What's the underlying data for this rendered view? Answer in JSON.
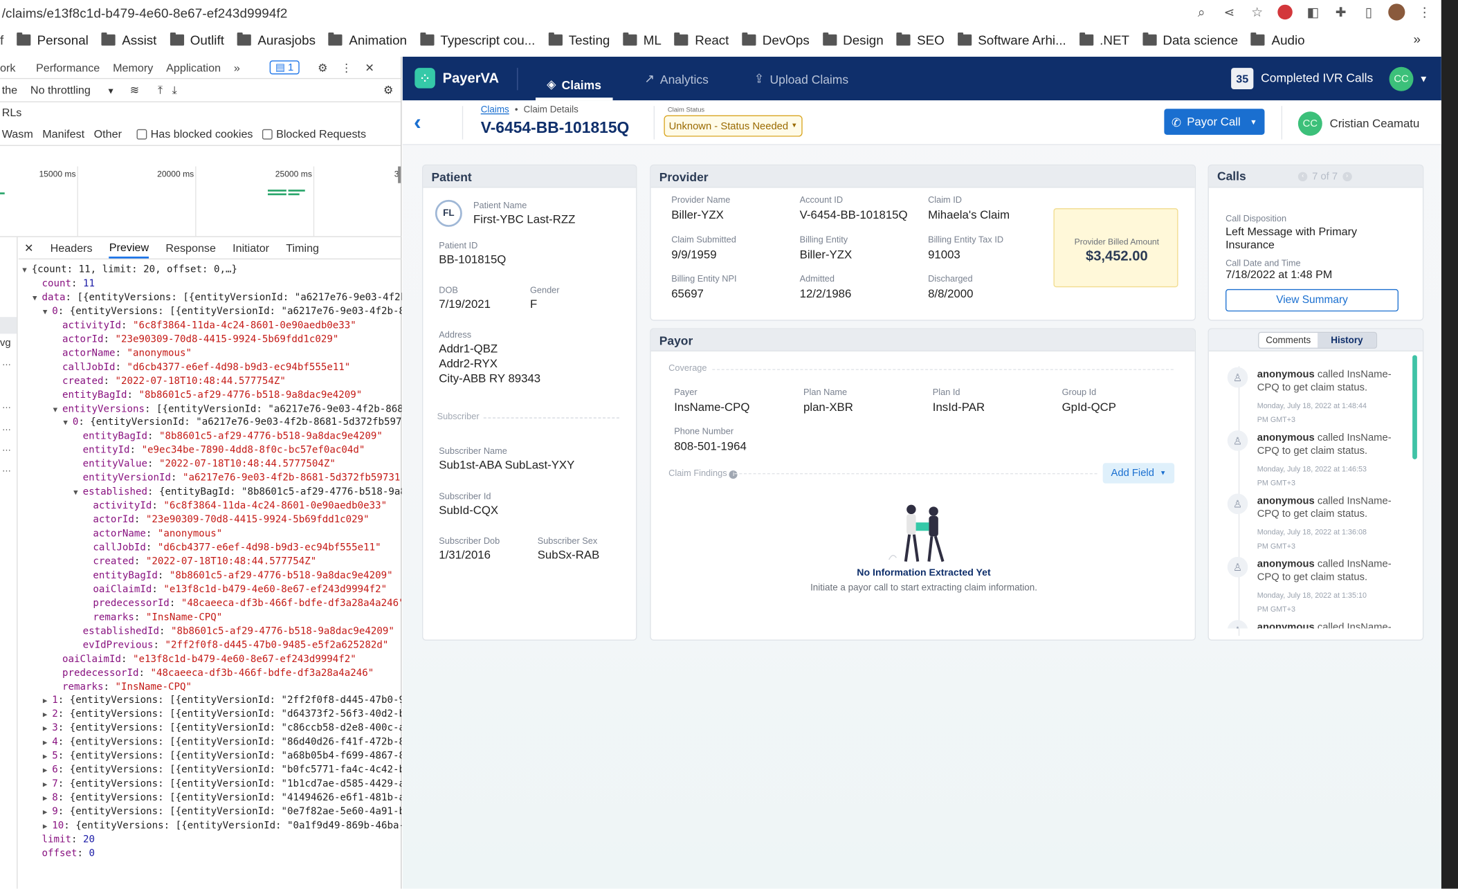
{
  "browser": {
    "url": "/claims/e13f8c1d-b479-4e60-8e67-ef243d9994f2",
    "bookmarks": [
      "Personal",
      "Assist",
      "Outlift",
      "Aurasjobs",
      "Animation",
      "Typescript cou...",
      "Testing",
      "ML",
      "React",
      "DevOps",
      "Design",
      "SEO",
      "Software Arhi...",
      ".NET",
      "Data science",
      "Audio"
    ],
    "more": "»"
  },
  "devtools": {
    "top_tabs": [
      "ork",
      "Performance",
      "Memory",
      "Application",
      "»"
    ],
    "issues_count": "1",
    "throttle_prefix": "the",
    "throttling": "No throttling",
    "urls_label": "RLs",
    "filters": [
      "Wasm",
      "Manifest",
      "Other"
    ],
    "checkbox_blocked_cookies": "Has blocked cookies",
    "checkbox_blocked_requests": "Blocked Requests",
    "timeline": [
      "15000 ms",
      "20000 ms",
      "25000 ms",
      "3"
    ],
    "panel_tabs": [
      "Headers",
      "Preview",
      "Response",
      "Initiator",
      "Timing"
    ],
    "side_labels": [
      "vg"
    ],
    "json_lines": [
      {
        "t": "▼",
        "i": 0,
        "c": [
          [
            "p",
            "{count: 11, limit: 20, offset: 0,…}"
          ]
        ]
      },
      {
        "t": "",
        "i": 1,
        "c": [
          [
            "k",
            "count"
          ],
          [
            "p",
            ": "
          ],
          [
            "n",
            "11"
          ]
        ]
      },
      {
        "t": "▼",
        "i": 1,
        "c": [
          [
            "k",
            "data"
          ],
          [
            "p",
            ": [{entityVersions: [{entityVersionId: \"a6217e76-9e03-4f2b-"
          ]
        ]
      },
      {
        "t": "▼",
        "i": 2,
        "c": [
          [
            "k",
            "0"
          ],
          [
            "p",
            ": {entityVersions: [{entityVersionId: \"a6217e76-9e03-4f2b-86"
          ]
        ]
      },
      {
        "t": "",
        "i": 3,
        "c": [
          [
            "k",
            "activityId"
          ],
          [
            "p",
            ": "
          ],
          [
            "s",
            "\"6c8f3864-11da-4c24-8601-0e90aedb0e33\""
          ]
        ]
      },
      {
        "t": "",
        "i": 3,
        "c": [
          [
            "k",
            "actorId"
          ],
          [
            "p",
            ": "
          ],
          [
            "s",
            "\"23e90309-70d8-4415-9924-5b69fdd1c029\""
          ]
        ]
      },
      {
        "t": "",
        "i": 3,
        "c": [
          [
            "k",
            "actorName"
          ],
          [
            "p",
            ": "
          ],
          [
            "s",
            "\"anonymous\""
          ]
        ]
      },
      {
        "t": "",
        "i": 3,
        "c": [
          [
            "k",
            "callJobId"
          ],
          [
            "p",
            ": "
          ],
          [
            "s",
            "\"d6cb4377-e6ef-4d98-b9d3-ec94bf555e11\""
          ]
        ]
      },
      {
        "t": "",
        "i": 3,
        "c": [
          [
            "k",
            "created"
          ],
          [
            "p",
            ": "
          ],
          [
            "s",
            "\"2022-07-18T10:48:44.577754Z\""
          ]
        ]
      },
      {
        "t": "",
        "i": 3,
        "c": [
          [
            "k",
            "entityBagId"
          ],
          [
            "p",
            ": "
          ],
          [
            "s",
            "\"8b8601c5-af29-4776-b518-9a8dac9e4209\""
          ]
        ]
      },
      {
        "t": "▼",
        "i": 3,
        "c": [
          [
            "k",
            "entityVersions"
          ],
          [
            "p",
            ": [{entityVersionId: \"a6217e76-9e03-4f2b-8681"
          ]
        ]
      },
      {
        "t": "▼",
        "i": 4,
        "c": [
          [
            "k",
            "0"
          ],
          [
            "p",
            ": {entityVersionId: \"a6217e76-9e03-4f2b-8681-5d372fb59731"
          ]
        ]
      },
      {
        "t": "",
        "i": 5,
        "c": [
          [
            "k",
            "entityBagId"
          ],
          [
            "p",
            ": "
          ],
          [
            "s",
            "\"8b8601c5-af29-4776-b518-9a8dac9e4209\""
          ]
        ]
      },
      {
        "t": "",
        "i": 5,
        "c": [
          [
            "k",
            "entityId"
          ],
          [
            "p",
            ": "
          ],
          [
            "s",
            "\"e9ec34be-7890-4dd8-8f0c-bc57ef0ac04d\""
          ]
        ]
      },
      {
        "t": "",
        "i": 5,
        "c": [
          [
            "k",
            "entityValue"
          ],
          [
            "p",
            ": "
          ],
          [
            "s",
            "\"2022-07-18T10:48:44.5777504Z\""
          ]
        ]
      },
      {
        "t": "",
        "i": 5,
        "c": [
          [
            "k",
            "entityVersionId"
          ],
          [
            "p",
            ": "
          ],
          [
            "s",
            "\"a6217e76-9e03-4f2b-8681-5d372fb59731\""
          ]
        ]
      },
      {
        "t": "▼",
        "i": 5,
        "c": [
          [
            "k",
            "established"
          ],
          [
            "p",
            ": {entityBagId: \"8b8601c5-af29-4776-b518-9a8d"
          ]
        ]
      },
      {
        "t": "",
        "i": 6,
        "c": [
          [
            "k",
            "activityId"
          ],
          [
            "p",
            ": "
          ],
          [
            "s",
            "\"6c8f3864-11da-4c24-8601-0e90aedb0e33\""
          ]
        ]
      },
      {
        "t": "",
        "i": 6,
        "c": [
          [
            "k",
            "actorId"
          ],
          [
            "p",
            ": "
          ],
          [
            "s",
            "\"23e90309-70d8-4415-9924-5b69fdd1c029\""
          ]
        ]
      },
      {
        "t": "",
        "i": 6,
        "c": [
          [
            "k",
            "actorName"
          ],
          [
            "p",
            ": "
          ],
          [
            "s",
            "\"anonymous\""
          ]
        ]
      },
      {
        "t": "",
        "i": 6,
        "c": [
          [
            "k",
            "callJobId"
          ],
          [
            "p",
            ": "
          ],
          [
            "s",
            "\"d6cb4377-e6ef-4d98-b9d3-ec94bf555e11\""
          ]
        ]
      },
      {
        "t": "",
        "i": 6,
        "c": [
          [
            "k",
            "created"
          ],
          [
            "p",
            ": "
          ],
          [
            "s",
            "\"2022-07-18T10:48:44.577754Z\""
          ]
        ]
      },
      {
        "t": "",
        "i": 6,
        "c": [
          [
            "k",
            "entityBagId"
          ],
          [
            "p",
            ": "
          ],
          [
            "s",
            "\"8b8601c5-af29-4776-b518-9a8dac9e4209\""
          ]
        ]
      },
      {
        "t": "",
        "i": 6,
        "c": [
          [
            "k",
            "oaiClaimId"
          ],
          [
            "p",
            ": "
          ],
          [
            "s",
            "\"e13f8c1d-b479-4e60-8e67-ef243d9994f2\""
          ]
        ]
      },
      {
        "t": "",
        "i": 6,
        "c": [
          [
            "k",
            "predecessorId"
          ],
          [
            "p",
            ": "
          ],
          [
            "s",
            "\"48caeeca-df3b-466f-bdfe-df3a28a4a246\""
          ]
        ]
      },
      {
        "t": "",
        "i": 6,
        "c": [
          [
            "k",
            "remarks"
          ],
          [
            "p",
            ": "
          ],
          [
            "s",
            "\"InsName-CPQ\""
          ]
        ]
      },
      {
        "t": "",
        "i": 5,
        "c": [
          [
            "k",
            "establishedId"
          ],
          [
            "p",
            ": "
          ],
          [
            "s",
            "\"8b8601c5-af29-4776-b518-9a8dac9e4209\""
          ]
        ]
      },
      {
        "t": "",
        "i": 5,
        "c": [
          [
            "k",
            "evIdPrevious"
          ],
          [
            "p",
            ": "
          ],
          [
            "s",
            "\"2ff2f0f8-d445-47b0-9485-e5f2a625282d\""
          ]
        ]
      },
      {
        "t": "",
        "i": 3,
        "c": [
          [
            "k",
            "oaiClaimId"
          ],
          [
            "p",
            ": "
          ],
          [
            "s",
            "\"e13f8c1d-b479-4e60-8e67-ef243d9994f2\""
          ]
        ]
      },
      {
        "t": "",
        "i": 3,
        "c": [
          [
            "k",
            "predecessorId"
          ],
          [
            "p",
            ": "
          ],
          [
            "s",
            "\"48caeeca-df3b-466f-bdfe-df3a28a4a246\""
          ]
        ]
      },
      {
        "t": "",
        "i": 3,
        "c": [
          [
            "k",
            "remarks"
          ],
          [
            "p",
            ": "
          ],
          [
            "s",
            "\"InsName-CPQ\""
          ]
        ]
      },
      {
        "t": "▶",
        "i": 2,
        "c": [
          [
            "k",
            "1"
          ],
          [
            "p",
            ": {entityVersions: [{entityVersionId: \"2ff2f0f8-d445-47b0-94"
          ]
        ]
      },
      {
        "t": "▶",
        "i": 2,
        "c": [
          [
            "k",
            "2"
          ],
          [
            "p",
            ": {entityVersions: [{entityVersionId: \"d64373f2-56f3-40d2-b7"
          ]
        ]
      },
      {
        "t": "▶",
        "i": 2,
        "c": [
          [
            "k",
            "3"
          ],
          [
            "p",
            ": {entityVersions: [{entityVersionId: \"c86ccb58-d2e8-400c-ae"
          ]
        ]
      },
      {
        "t": "▶",
        "i": 2,
        "c": [
          [
            "k",
            "4"
          ],
          [
            "p",
            ": {entityVersions: [{entityVersionId: \"86d40d26-f41f-472b-86"
          ]
        ]
      },
      {
        "t": "▶",
        "i": 2,
        "c": [
          [
            "k",
            "5"
          ],
          [
            "p",
            ": {entityVersions: [{entityVersionId: \"a68b05b4-f699-4867-86"
          ]
        ]
      },
      {
        "t": "▶",
        "i": 2,
        "c": [
          [
            "k",
            "6"
          ],
          [
            "p",
            ": {entityVersions: [{entityVersionId: \"b0fc5771-fa4c-4c42-bd"
          ]
        ]
      },
      {
        "t": "▶",
        "i": 2,
        "c": [
          [
            "k",
            "7"
          ],
          [
            "p",
            ": {entityVersions: [{entityVersionId: \"1b1cd7ae-d585-4429-a5"
          ]
        ]
      },
      {
        "t": "▶",
        "i": 2,
        "c": [
          [
            "k",
            "8"
          ],
          [
            "p",
            ": {entityVersions: [{entityVersionId: \"41494626-e6f1-481b-a1"
          ]
        ]
      },
      {
        "t": "▶",
        "i": 2,
        "c": [
          [
            "k",
            "9"
          ],
          [
            "p",
            ": {entityVersions: [{entityVersionId: \"0e7f82ae-5e60-4a91-b1"
          ]
        ]
      },
      {
        "t": "▶",
        "i": 2,
        "c": [
          [
            "k",
            "10"
          ],
          [
            "p",
            ": {entityVersions: [{entityVersionId: \"0a1f9d49-869b-46ba-a"
          ]
        ]
      },
      {
        "t": "",
        "i": 1,
        "c": [
          [
            "k",
            "limit"
          ],
          [
            "p",
            ": "
          ],
          [
            "n",
            "20"
          ]
        ]
      },
      {
        "t": "",
        "i": 1,
        "c": [
          [
            "k",
            "offset"
          ],
          [
            "p",
            ": "
          ],
          [
            "n",
            "0"
          ]
        ]
      }
    ]
  },
  "app": {
    "brand": "PayerVA",
    "nav": {
      "claims": "Claims",
      "analytics": "Analytics",
      "upload": "Upload Claims"
    },
    "completed_count": "35",
    "completed_label": "Completed IVR Calls",
    "user_initials": "CC",
    "breadcrumb": {
      "link": "Claims",
      "sep": "•",
      "current": "Claim Details"
    },
    "claim_number": "V-6454-BB-101815Q",
    "claim_status_label": "Claim Status",
    "claim_status": "Unknown - Status Needed",
    "payor_call": "Payor Call",
    "user_name": "Cristian Ceamatu",
    "patient": {
      "title": "Patient",
      "initials": "FL",
      "name_label": "Patient Name",
      "name": "First-YBC Last-RZZ",
      "id_label": "Patient ID",
      "id": "BB-101815Q",
      "dob_label": "DOB",
      "dob": "7/19/2021",
      "gender_label": "Gender",
      "gender": "F",
      "address_label": "Address",
      "addr1": "Addr1-QBZ",
      "addr2": "Addr2-RYX",
      "city": "City-ABB RY 89343",
      "subscriber_section": "Subscriber",
      "sub_name_label": "Subscriber Name",
      "sub_name": "Sub1st-ABA SubLast-YXY",
      "sub_id_label": "Subscriber Id",
      "sub_id": "SubId-CQX",
      "sub_dob_label": "Subscriber Dob",
      "sub_dob": "1/31/2016",
      "sub_sex_label": "Subscriber Sex",
      "sub_sex": "SubSx-RAB"
    },
    "provider": {
      "title": "Provider",
      "fields": [
        {
          "label": "Provider Name",
          "value": "Biller-YZX"
        },
        {
          "label": "Account ID",
          "value": "V-6454-BB-101815Q"
        },
        {
          "label": "Claim ID",
          "value": "Mihaela's Claim"
        },
        {
          "label": "Claim Submitted",
          "value": "9/9/1959"
        },
        {
          "label": "Billing Entity",
          "value": "Biller-YZX"
        },
        {
          "label": "Billing Entity Tax ID",
          "value": "91003"
        },
        {
          "label": "Billing Entity NPI",
          "value": "65697"
        },
        {
          "label": "Admitted",
          "value": "12/2/1986"
        },
        {
          "label": "Discharged",
          "value": "8/8/2000"
        }
      ],
      "billed_label": "Provider Billed Amount",
      "billed_amount": "$3,452.00"
    },
    "payor": {
      "title": "Payor",
      "coverage": "Coverage",
      "fields": [
        {
          "label": "Payer",
          "value": "InsName-CPQ"
        },
        {
          "label": "Plan Name",
          "value": "plan-XBR"
        },
        {
          "label": "Plan Id",
          "value": "InsId-PAR"
        },
        {
          "label": "Group Id",
          "value": "GpId-QCP"
        },
        {
          "label": "Phone Number",
          "value": "808-501-1964"
        }
      ],
      "findings_label": "Claim Findings",
      "add_field": "Add Field",
      "empty_title": "No Information Extracted Yet",
      "empty_sub": "Initiate a payor call to start extracting claim information."
    },
    "calls": {
      "title": "Calls",
      "pager": "7 of 7",
      "disposition_label": "Call Disposition",
      "disposition": "Left Message with Primary Insurance",
      "datetime_label": "Call Date and Time",
      "datetime": "7/18/2022 at 1:48 PM",
      "view_summary": "View Summary"
    },
    "history": {
      "tab_comments": "Comments",
      "tab_history": "History",
      "items": [
        {
          "actor": "anonymous",
          "text": "called InsName-CPQ to get claim status.",
          "date": "Monday, July 18, 2022 at 1:48:44 PM GMT+3"
        },
        {
          "actor": "anonymous",
          "text": "called InsName-CPQ to get claim status.",
          "date": "Monday, July 18, 2022 at 1:46:53 PM GMT+3"
        },
        {
          "actor": "anonymous",
          "text": "called InsName-CPQ to get claim status.",
          "date": "Monday, July 18, 2022 at 1:36:08 PM GMT+3"
        },
        {
          "actor": "anonymous",
          "text": "called InsName-CPQ to get claim status.",
          "date": "Monday, July 18, 2022 at 1:35:10 PM GMT+3"
        },
        {
          "actor": "anonymous",
          "text": "called InsName-",
          "date": ""
        }
      ]
    },
    "colors": {
      "nav": "#0f2f6b",
      "accent": "#1a6fd0",
      "teal": "#35c9a8",
      "status": "#c88a00"
    }
  }
}
